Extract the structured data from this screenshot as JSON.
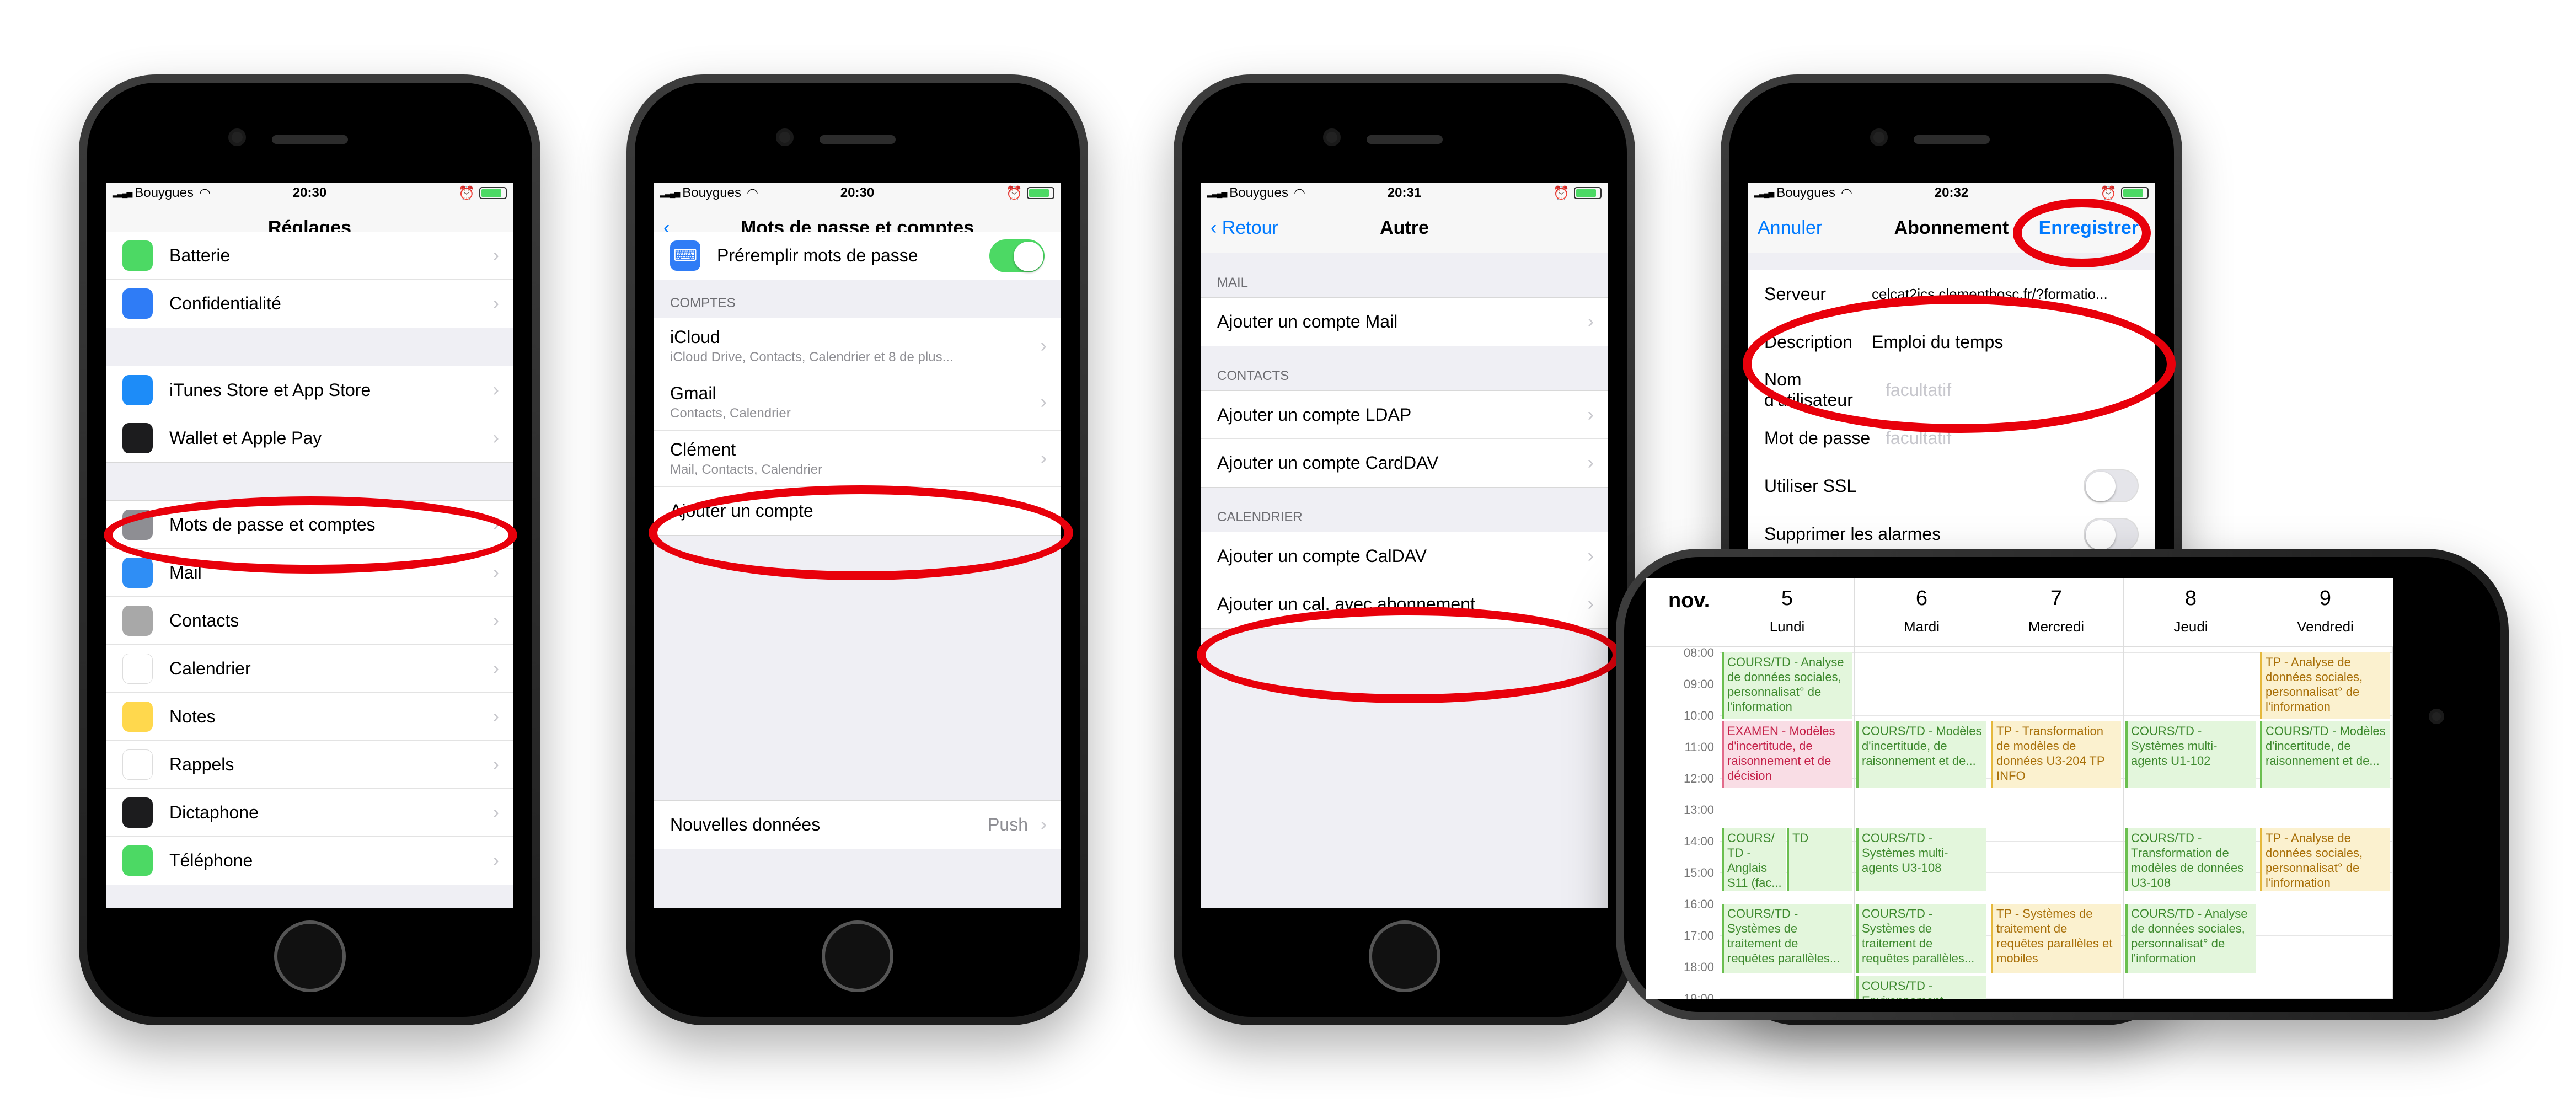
{
  "status_bar": {
    "carrier": "Bouygues",
    "times": [
      "20:30",
      "20:30",
      "20:31",
      "20:32"
    ]
  },
  "screen1": {
    "title": "Réglages",
    "items_a": [
      {
        "label": "Batterie",
        "icon": "battery-icon",
        "color": "#4cd964"
      },
      {
        "label": "Confidentialité",
        "icon": "hand-icon",
        "color": "#2f7cf6"
      }
    ],
    "items_b": [
      {
        "label": "iTunes Store et App Store",
        "icon": "app-store-icon",
        "color": "#1d8cf8"
      },
      {
        "label": "Wallet et Apple Pay",
        "icon": "wallet-icon",
        "color": "#1c1c1e"
      }
    ],
    "items_c": [
      {
        "label": "Mots de passe et comptes",
        "icon": "key-icon",
        "color": "#8e8e93"
      },
      {
        "label": "Mail",
        "icon": "mail-icon",
        "color": "#2f8ef5"
      },
      {
        "label": "Contacts",
        "icon": "contacts-icon",
        "color": "#a8a8a8"
      },
      {
        "label": "Calendrier",
        "icon": "calendar-icon",
        "color": "#ffffff"
      },
      {
        "label": "Notes",
        "icon": "notes-icon",
        "color": "#ffd84d"
      },
      {
        "label": "Rappels",
        "icon": "reminders-icon",
        "color": "#ffffff"
      },
      {
        "label": "Dictaphone",
        "icon": "voice-memo-icon",
        "color": "#1c1c1e"
      },
      {
        "label": "Téléphone",
        "icon": "phone-icon",
        "color": "#4cd964"
      }
    ]
  },
  "screen2": {
    "title": "Mots de passe et comptes",
    "autofill": "Préremplir mots de passe",
    "section": "COMPTES",
    "accounts": [
      {
        "label": "iCloud",
        "sub": "iCloud Drive, Contacts, Calendrier et 8 de plus..."
      },
      {
        "label": "Gmail",
        "sub": "Contacts, Calendrier"
      },
      {
        "label": "Clément",
        "sub": "Mail, Contacts, Calendrier"
      }
    ],
    "add": "Ajouter un compte",
    "fetch_label": "Nouvelles données",
    "fetch_value": "Push"
  },
  "screen3": {
    "back": "Retour",
    "title": "Autre",
    "sections": [
      {
        "header": "MAIL",
        "items": [
          "Ajouter un compte Mail"
        ]
      },
      {
        "header": "CONTACTS",
        "items": [
          "Ajouter un compte LDAP",
          "Ajouter un compte CardDAV"
        ]
      },
      {
        "header": "CALENDRIER",
        "items": [
          "Ajouter un compte CalDAV",
          "Ajouter un cal. avec abonnement"
        ]
      }
    ]
  },
  "screen4": {
    "cancel": "Annuler",
    "title": "Abonnement",
    "save": "Enregistrer",
    "server_label": "Serveur",
    "server_value": "celcat2ics.clementbosc.fr/?formatio...",
    "desc_label": "Description",
    "desc_value": "Emploi du temps",
    "user_label": "Nom d'utilisateur",
    "user_placeholder": "facultatif",
    "pass_label": "Mot de passe",
    "pass_placeholder": "facultatif",
    "ssl_label": "Utiliser SSL",
    "alarm_label": "Supprimer les alarmes"
  },
  "calendar": {
    "month": "nov.",
    "days": [
      {
        "num": "5",
        "name": "Lundi"
      },
      {
        "num": "6",
        "name": "Mardi"
      },
      {
        "num": "7",
        "name": "Mercredi"
      },
      {
        "num": "8",
        "name": "Jeudi"
      },
      {
        "num": "9",
        "name": "Vendredi"
      }
    ],
    "hours": [
      "08:00",
      "09:00",
      "10:00",
      "11:00",
      "12:00",
      "13:00",
      "14:00",
      "15:00",
      "16:00",
      "17:00",
      "18:00",
      "19:00"
    ],
    "events": [
      {
        "day": 0,
        "start": 8.0,
        "end": 10.1,
        "color": "g",
        "text": "COURS/TD - Analyse de données sociales, personnalisat° de l'information"
      },
      {
        "day": 0,
        "start": 10.2,
        "end": 12.3,
        "color": "r",
        "text": "EXAMEN - Modèles d'incertitude, de raisonnement et de décision"
      },
      {
        "day": 0,
        "start": 13.6,
        "end": 15.6,
        "color": "g",
        "text": "COURS/ TD - Anglais S11 (fac..."
      },
      {
        "day": 0.5,
        "start": 13.6,
        "end": 15.6,
        "color": "g",
        "text": "TD"
      },
      {
        "day": 0,
        "start": 16.0,
        "end": 18.2,
        "color": "g",
        "text": "COURS/TD - Systèmes de traitement de requêtes parallèles..."
      },
      {
        "day": 1,
        "start": 10.2,
        "end": 12.3,
        "color": "g",
        "text": "COURS/TD - Modèles d'incertitude, de raisonnement et de..."
      },
      {
        "day": 1,
        "start": 13.6,
        "end": 15.6,
        "color": "g",
        "text": "COURS/TD - Systèmes multi-agents U3-108"
      },
      {
        "day": 1,
        "start": 16.0,
        "end": 18.2,
        "color": "g",
        "text": "COURS/TD - Systèmes de traitement de requêtes parallèles..."
      },
      {
        "day": 1,
        "start": 18.3,
        "end": 19.5,
        "color": "g",
        "text": "COURS/TD - Environnement..."
      },
      {
        "day": 2,
        "start": 10.2,
        "end": 12.3,
        "color": "y",
        "text": "TP - Transformation de modèles de données U3-204 TP INFO"
      },
      {
        "day": 2,
        "start": 16.0,
        "end": 18.2,
        "color": "y",
        "text": "TP - Systèmes de traitement de requêtes parallèles et mobiles"
      },
      {
        "day": 3,
        "start": 10.2,
        "end": 12.3,
        "color": "g",
        "text": "COURS/TD - Systèmes multi-agents U1-102"
      },
      {
        "day": 3,
        "start": 13.6,
        "end": 15.6,
        "color": "g",
        "text": "COURS/TD - Transformation de modèles de données U3-108"
      },
      {
        "day": 3,
        "start": 16.0,
        "end": 18.2,
        "color": "g",
        "text": "COURS/TD - Analyse de données sociales, personnalisat° de l'information"
      },
      {
        "day": 4,
        "start": 8.0,
        "end": 10.1,
        "color": "y",
        "text": "TP - Analyse de données sociales, personnalisat° de l'information"
      },
      {
        "day": 4,
        "start": 10.2,
        "end": 12.3,
        "color": "g",
        "text": "COURS/TD - Modèles d'incertitude, de raisonnement et de..."
      },
      {
        "day": 4,
        "start": 13.6,
        "end": 15.6,
        "color": "y",
        "text": "TP - Analyse de données sociales, personnalisat° de l'information"
      }
    ]
  }
}
